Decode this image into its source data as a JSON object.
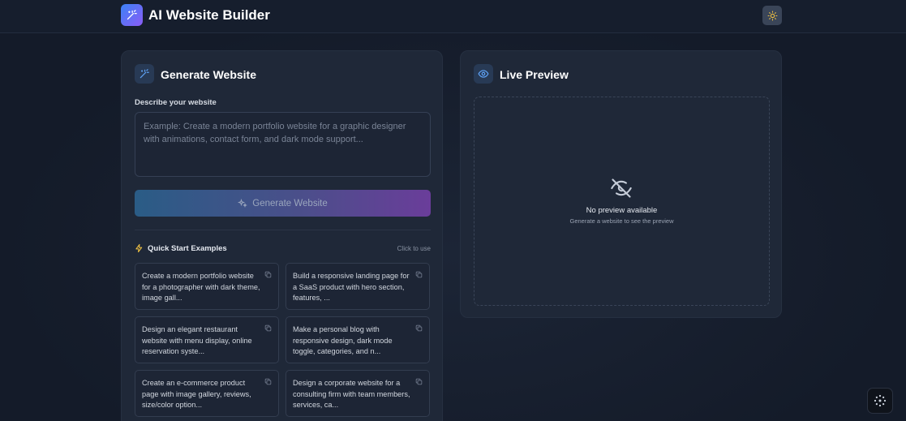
{
  "header": {
    "title": "AI Website Builder",
    "logo_icon": "magic-wand-icon",
    "theme_toggle_icon": "sun-icon"
  },
  "generator": {
    "title": "Generate Website",
    "icon": "magic-wand-icon",
    "field_label": "Describe your website",
    "prompt_value": "",
    "prompt_placeholder": "Example: Create a modern portfolio website for a graphic designer with animations, contact form, and dark mode support...",
    "generate_label": "Generate Website",
    "generate_icon": "sparkles-icon"
  },
  "quick_start": {
    "title": "Quick Start Examples",
    "hint": "Click to use",
    "examples": [
      {
        "text": "Create a modern portfolio website for a photographer with dark theme, image gall..."
      },
      {
        "text": "Build a responsive landing page for a SaaS product with hero section, features, ..."
      },
      {
        "text": "Design an elegant restaurant website with menu display, online reservation syste..."
      },
      {
        "text": "Make a personal blog with responsive design, dark mode toggle, categories, and n..."
      },
      {
        "text": "Create an e-commerce product page with image gallery, reviews, size/color option..."
      },
      {
        "text": "Design a corporate website for a consulting firm with team members, services, ca..."
      }
    ]
  },
  "preview": {
    "title": "Live Preview",
    "icon": "eye-icon",
    "empty_icon": "eye-off-icon",
    "empty_title": "No preview available",
    "empty_subtitle": "Generate a website to see the preview"
  },
  "colors": {
    "accent_start": "#3b82f6",
    "accent_end": "#8b5cf6",
    "background": "#151d2c",
    "panel": "#1f2838"
  }
}
